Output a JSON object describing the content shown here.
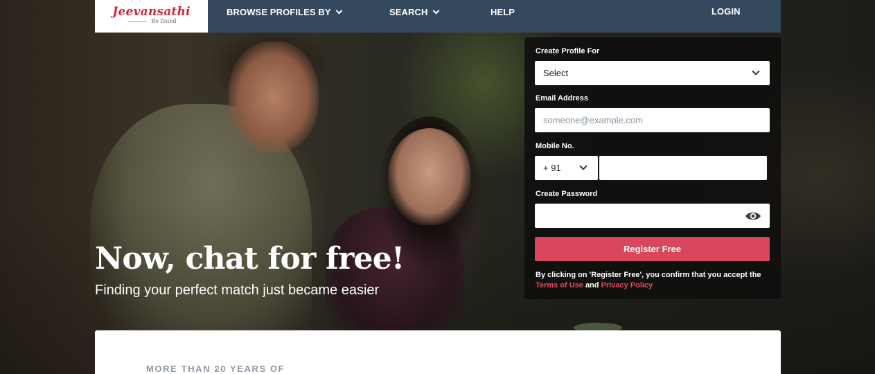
{
  "brand": {
    "logo_text": "Jeevansathi",
    "tagline": "Be found",
    "accent": "#d2283c"
  },
  "nav": {
    "browse_label": "BROWSE PROFILES BY",
    "search_label": "SEARCH",
    "help_label": "HELP",
    "login_label": "LOGIN",
    "background": "#34495e"
  },
  "form": {
    "profile_for_label": "Create Profile For",
    "profile_for_value": "Select",
    "email_label": "Email Address",
    "email_placeholder": "someone@example.com",
    "mobile_label": "Mobile No.",
    "country_code": "+ 91",
    "mobile_value": "",
    "password_label": "Create Password",
    "password_value": "",
    "password_toggle_icon": "eye-icon",
    "register_label": "Register Free",
    "register_color": "#d9475c",
    "consent_prefix": "By clicking on 'Register Free', you confirm that you accept the",
    "terms_label": "Terms of Use",
    "and_text": "and",
    "privacy_label": "Privacy Policy"
  },
  "hero": {
    "title": "Now, chat for free!",
    "subtitle": "Finding your perfect match just became easier"
  },
  "section": {
    "years_text": "MORE THAN 20 YEARS OF"
  }
}
